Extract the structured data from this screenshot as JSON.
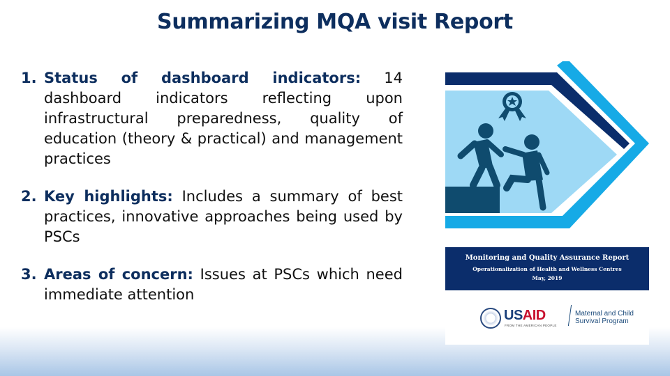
{
  "slide": {
    "title": "Summarizing MQA visit Report"
  },
  "items": [
    {
      "number": "1.",
      "heading": "Status of dashboard indicators:",
      "body": "14 dashboard indicators reflecting upon infrastructural preparedness, quality of education (theory & practical) and management practices"
    },
    {
      "number": "2.",
      "heading": "Key highlights:",
      "body": "Includes a summary of best practices, innovative approaches being used by PSCs"
    },
    {
      "number": "3.",
      "heading": "Areas of concern:",
      "body": "Issues at PSCs which need immediate attention"
    }
  ],
  "report_cover": {
    "title": "Monitoring and Quality Assurance Report",
    "subtitle": "Operationalization of Health and Wellness Centres",
    "date": "May, 2019",
    "logos": {
      "usaid_word_1": "US",
      "usaid_word_2": "AID",
      "usaid_tagline": "FROM THE AMERICAN PEOPLE",
      "mcsp_line1": "Maternal and Child",
      "mcsp_line2": "Survival Program"
    },
    "colors": {
      "navy": "#0b2d6b",
      "sky": "#16aae6",
      "light_panel": "#9ed9f5",
      "figure": "#0f4b6e"
    }
  }
}
